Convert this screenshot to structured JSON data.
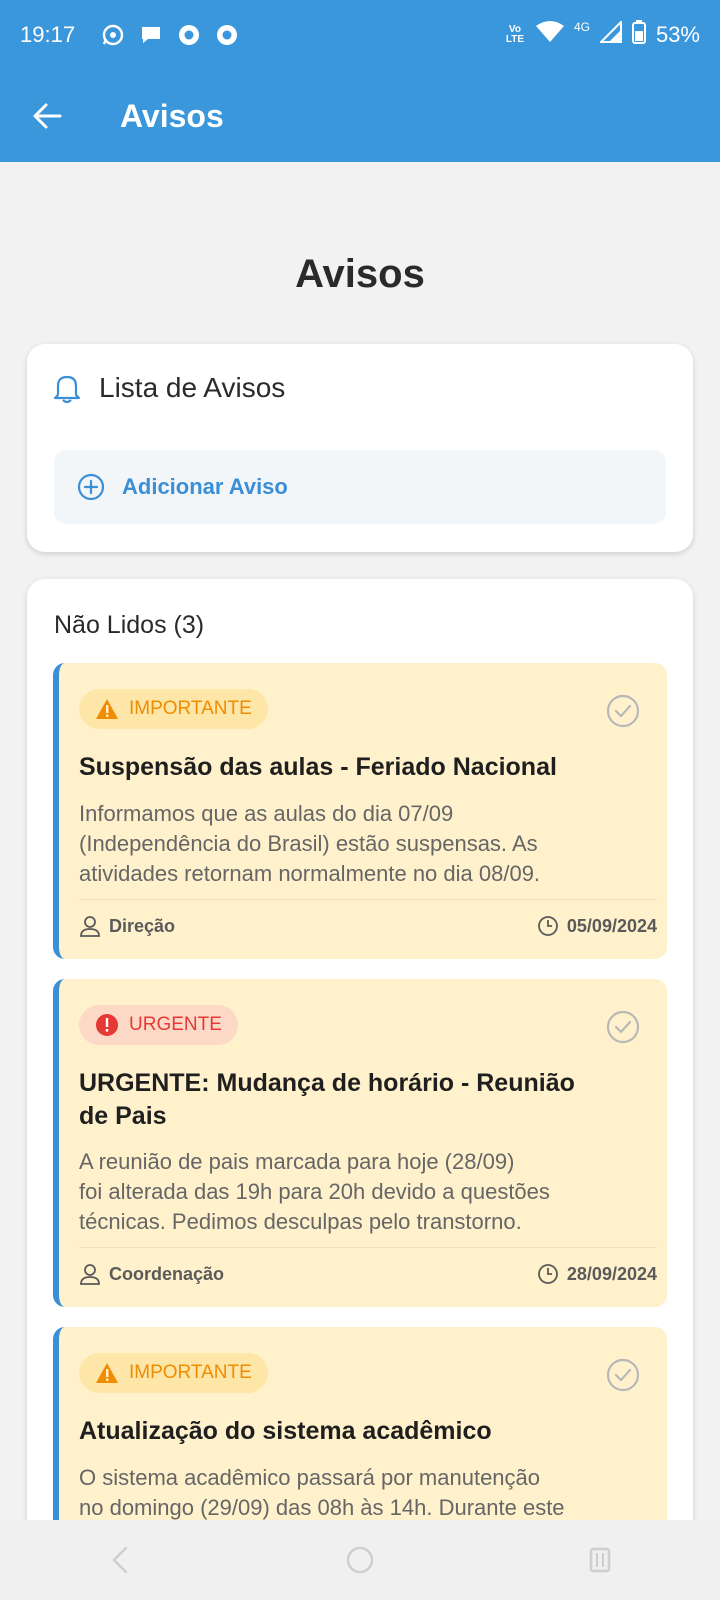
{
  "status_bar": {
    "time": "19:17",
    "notification_icons": [
      "whatsapp-icon",
      "chat-icon",
      "chrome-icon",
      "chrome-icon"
    ],
    "volte": "Vo LTE",
    "network": "4G",
    "battery": "53%"
  },
  "app_bar": {
    "title": "Avisos"
  },
  "page": {
    "title": "Avisos"
  },
  "list_card": {
    "title": "Lista de Avisos",
    "add_button": "Adicionar Aviso"
  },
  "unread": {
    "title": "Não Lidos (3)",
    "notices": [
      {
        "badge": "IMPORTANTE",
        "title": "Suspensão das aulas - Feriado Nacional",
        "body_lines": [
          "Informamos que as aulas do dia 07/09",
          "(Independência do Brasil) estão suspensas. As",
          "atividades retornam normalmente no dia 08/09."
        ],
        "author": "Direção",
        "date": "05/09/2024"
      },
      {
        "badge": "URGENTE",
        "title_lines": [
          "URGENTE: Mudança de horário - Reunião",
          "de Pais"
        ],
        "body_lines": [
          "A reunião de pais marcada para hoje (28/09)",
          "foi alterada das 19h para 20h devido a questões",
          "técnicas. Pedimos desculpas pelo transtorno."
        ],
        "author": "Coordenação",
        "date": "28/09/2024"
      },
      {
        "badge": "IMPORTANTE",
        "title": "Atualização do sistema acadêmico",
        "body_lines": [
          "O sistema acadêmico passará por manutenção",
          "no domingo (29/09) das 08h às 14h. Durante este"
        ]
      }
    ]
  },
  "colors": {
    "primary": "#3a97dc",
    "important": "#f08c00",
    "urgent": "#e53935",
    "notice_bg": "#fff1cc"
  }
}
